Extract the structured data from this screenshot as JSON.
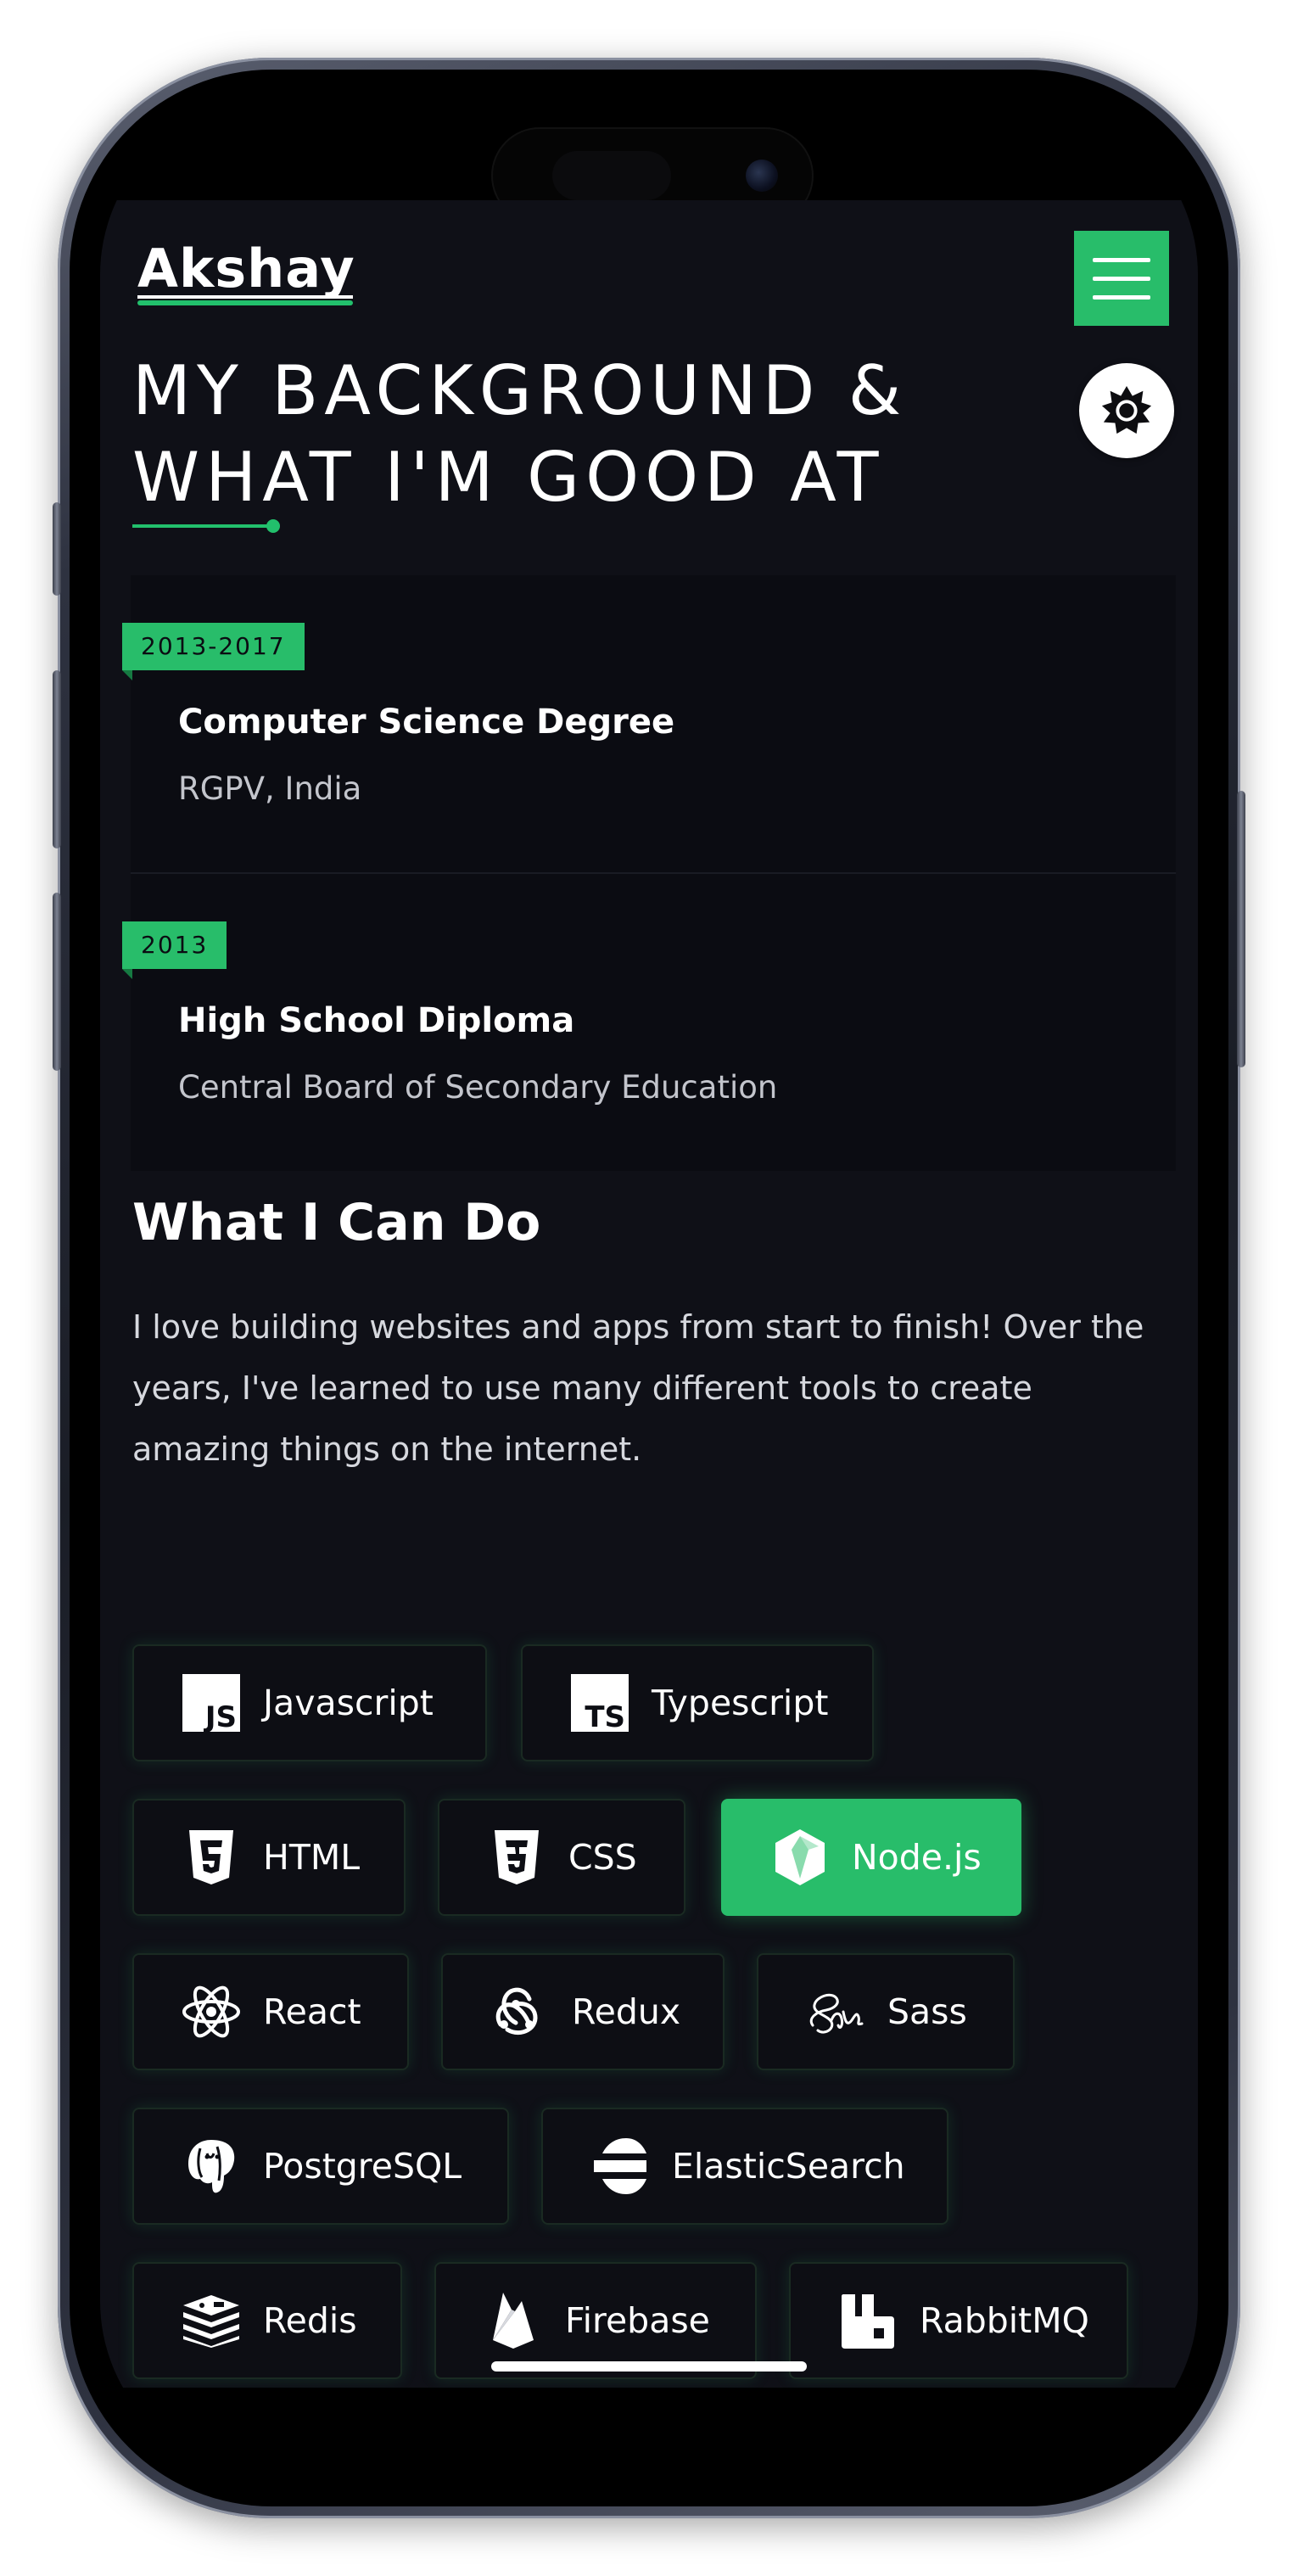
{
  "header": {
    "logo": "Akshay",
    "menu_label": "",
    "theme_label": ""
  },
  "section": {
    "title": "MY BACKGROUND & WHAT I'M GOOD AT"
  },
  "education": [
    {
      "years": "2013-2017",
      "title": "Computer Science Degree",
      "institution": "RGPV, India"
    },
    {
      "years": "2013",
      "title": "High School Diploma",
      "institution": "Central Board of Secondary Education"
    }
  ],
  "skills_intro": {
    "heading": "What I Can Do",
    "text": "I love building websites and apps from start to finish! Over the years, I've learned to use many different tools to create amazing things on the internet."
  },
  "skills": [
    {
      "label": "Javascript",
      "icon": "javascript-icon"
    },
    {
      "label": "Typescript",
      "icon": "typescript-icon"
    },
    {
      "label": "HTML",
      "icon": "html5-icon"
    },
    {
      "label": "CSS",
      "icon": "css3-icon"
    },
    {
      "label": "Node.js",
      "icon": "nodejs-icon",
      "active": true
    },
    {
      "label": "React",
      "icon": "react-icon"
    },
    {
      "label": "Redux",
      "icon": "redux-icon"
    },
    {
      "label": "Sass",
      "icon": "sass-icon"
    },
    {
      "label": "PostgreSQL",
      "icon": "postgresql-icon"
    },
    {
      "label": "ElasticSearch",
      "icon": "elasticsearch-icon"
    },
    {
      "label": "Redis",
      "icon": "redis-icon"
    },
    {
      "label": "Firebase",
      "icon": "firebase-icon"
    },
    {
      "label": "RabbitMQ",
      "icon": "rabbitmq-icon"
    }
  ],
  "colors": {
    "accent": "#28bd6a",
    "background": "#0f1017",
    "card": "#0b0c12"
  }
}
